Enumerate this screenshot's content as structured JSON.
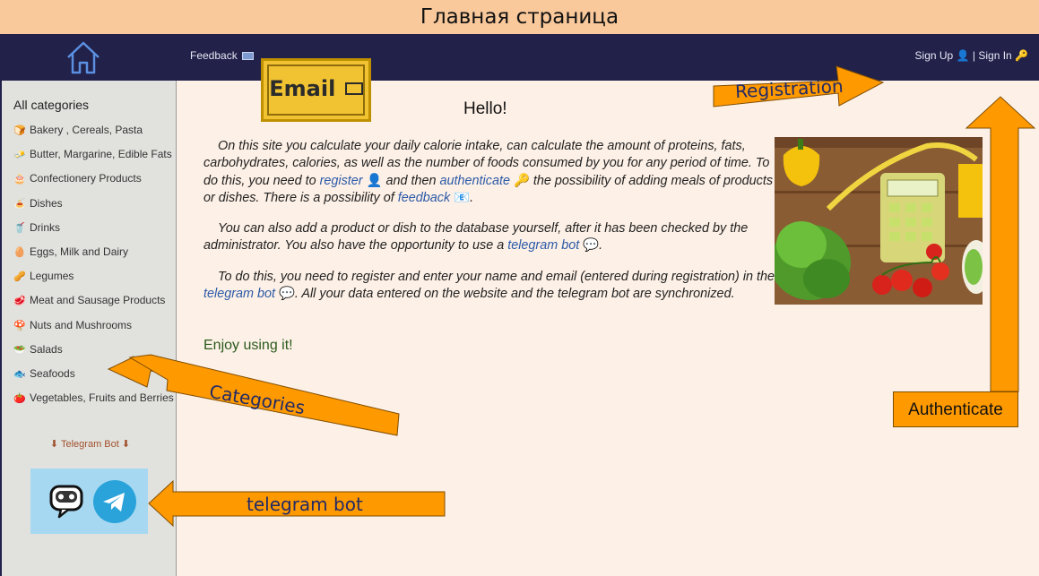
{
  "window": {
    "title": "Главная страница"
  },
  "navbar": {
    "feedback_label": "Feedback",
    "sign_up_label": "Sign Up",
    "separator": "|",
    "sign_in_label": "Sign In"
  },
  "sidebar": {
    "heading": "All categories",
    "categories": [
      {
        "label": "Bakery , Cereals, Pasta",
        "icon": "bread-icon",
        "glyph": "🍞"
      },
      {
        "label": "Butter, Margarine, Edible Fats",
        "icon": "butter-icon",
        "glyph": "🧈"
      },
      {
        "label": "Confectionery Products",
        "icon": "cake-icon",
        "glyph": "🎂"
      },
      {
        "label": "Dishes",
        "icon": "dish-icon",
        "glyph": "🍝"
      },
      {
        "label": "Drinks",
        "icon": "drink-icon",
        "glyph": "🥤"
      },
      {
        "label": "Eggs, Milk and Dairy",
        "icon": "egg-icon",
        "glyph": "🥚"
      },
      {
        "label": "Legumes",
        "icon": "legume-icon",
        "glyph": "🥜"
      },
      {
        "label": "Meat and Sausage Products",
        "icon": "meat-icon",
        "glyph": "🥩"
      },
      {
        "label": "Nuts and Mushrooms",
        "icon": "mushroom-icon",
        "glyph": "🍄"
      },
      {
        "label": "Salads",
        "icon": "salad-icon",
        "glyph": "🥗"
      },
      {
        "label": "Seafoods",
        "icon": "fish-icon",
        "glyph": "🐟"
      },
      {
        "label": "Vegetables, Fruits and Berries",
        "icon": "tomato-icon",
        "glyph": "🍅"
      }
    ],
    "telegram_label": "⬇ Telegram Bot ⬇"
  },
  "main": {
    "greeting": "Hello!",
    "p1": {
      "t1": "On this site you calculate your daily calorie intake, can calculate the amount of proteins, fats, carbohydrates, calories, as well as the number of foods consumed by you for any period of time. To do this, you need to ",
      "register_link": "register",
      "t2": " and then ",
      "authenticate_link": "authenticate",
      "t3": " the possibility of adding meals of products or dishes. There is a possibility of ",
      "feedback_link": "feedback",
      "t4": "."
    },
    "p2": {
      "t1": "You can also add a product or dish to the database yourself, after it has been checked by the administrator. You also have the opportunity to use a ",
      "telegram_link": "telegram bot",
      "t2": "."
    },
    "p3": {
      "t1": "To do this, you need to register and enter your name and email (entered during registration) in the ",
      "telegram_link": "telegram bot",
      "t2": ". All your data entered on the website and the telegram bot are synchronized."
    },
    "enjoy": "Enjoy using it!"
  },
  "annotations": {
    "email": "Email",
    "registration": "Registration",
    "authenticate": "Authenticate",
    "categories": "Categories",
    "telegram_bot": "telegram bot"
  },
  "colors": {
    "title_bar": "#f9c89b",
    "navbar": "#21214a",
    "sidebar": "#e1e1de",
    "page": "#fdf0e6",
    "link": "#2c5aa8",
    "annotation_arrow": "#ff9900",
    "annotation_text": "#222a66"
  }
}
